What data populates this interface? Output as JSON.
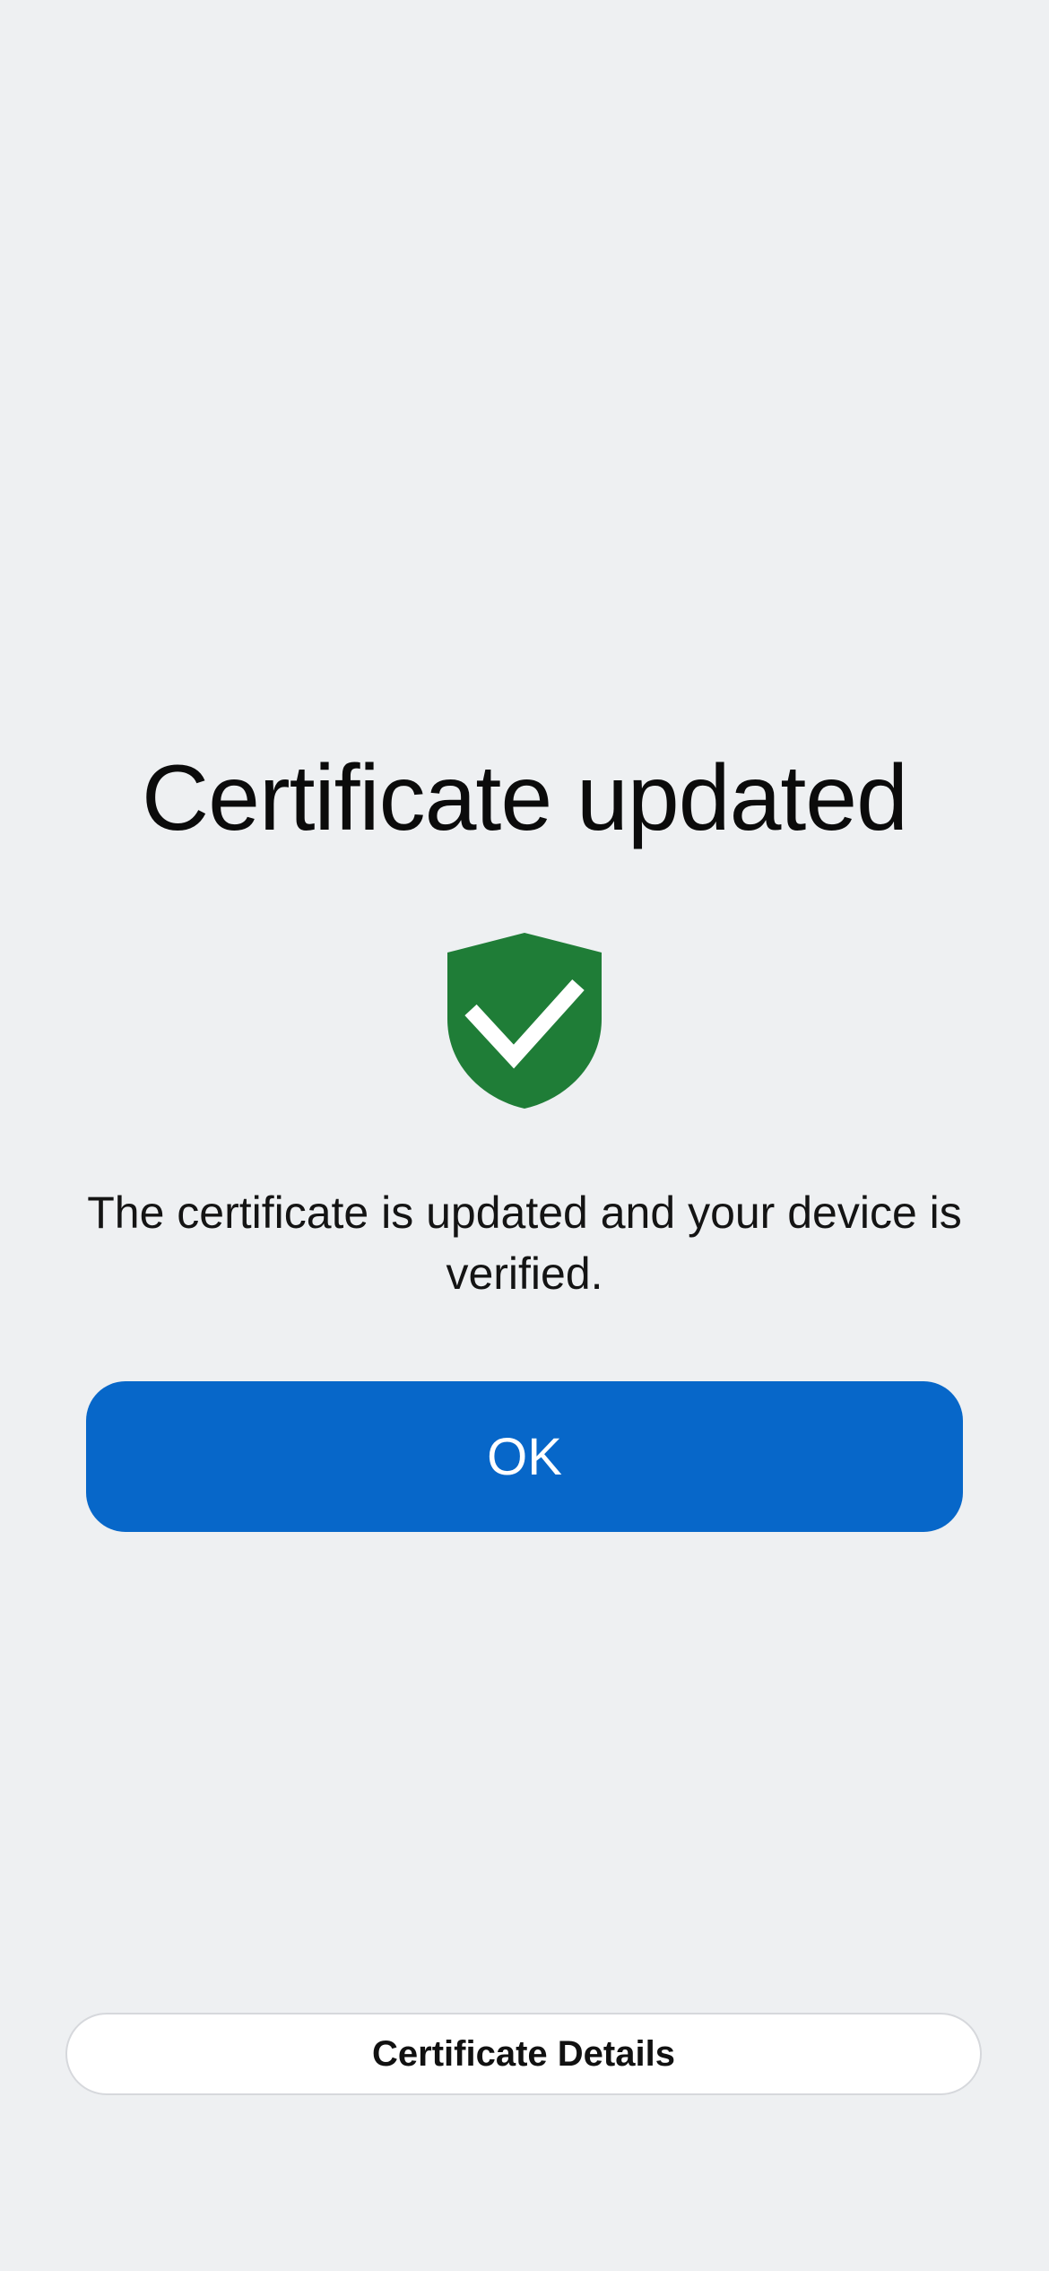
{
  "screen": {
    "title": "Certificate updated",
    "message": "The certificate is updated and your device is verified.",
    "status_icon": "shield-check-icon"
  },
  "actions": {
    "ok_label": "OK",
    "details_label": "Certificate Details"
  },
  "colors": {
    "background": "#eef0f2",
    "primary_button": "#0767c9",
    "shield": "#1f7d37",
    "text": "#111111"
  }
}
